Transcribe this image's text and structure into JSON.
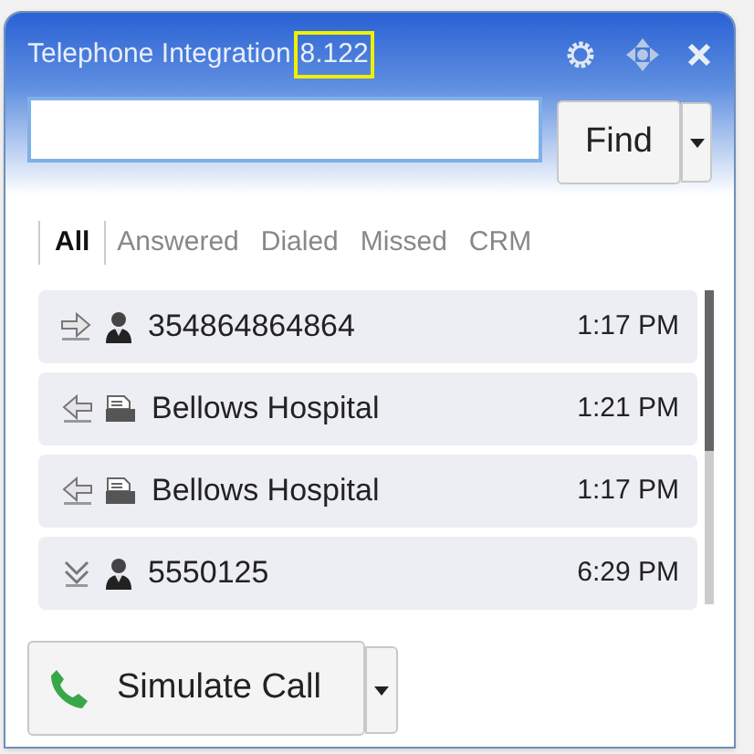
{
  "window": {
    "title": "Telephone Integration",
    "version": "8.122",
    "version_highlighted": true
  },
  "find_button": {
    "label": "Find"
  },
  "tabs": [
    {
      "label": "All",
      "selected": true
    },
    {
      "label": "Answered",
      "selected": false
    },
    {
      "label": "Dialed",
      "selected": false
    },
    {
      "label": "Missed",
      "selected": false
    },
    {
      "label": "CRM",
      "selected": false
    }
  ],
  "calls": [
    {
      "kind": "outgoing",
      "contact": {
        "kind": "person"
      },
      "name": "354864864864",
      "time": "1:17 PM"
    },
    {
      "kind": "incoming",
      "contact": {
        "kind": "company"
      },
      "name": "Bellows Hospital",
      "time": "1:21 PM"
    },
    {
      "kind": "incoming",
      "contact": {
        "kind": "company"
      },
      "name": "Bellows Hospital",
      "time": "1:17 PM"
    },
    {
      "kind": "missed",
      "contact": {
        "kind": "person"
      },
      "name": "5550125",
      "time": "6:29 PM"
    }
  ],
  "simulate_button": {
    "label": "Simulate Call"
  }
}
